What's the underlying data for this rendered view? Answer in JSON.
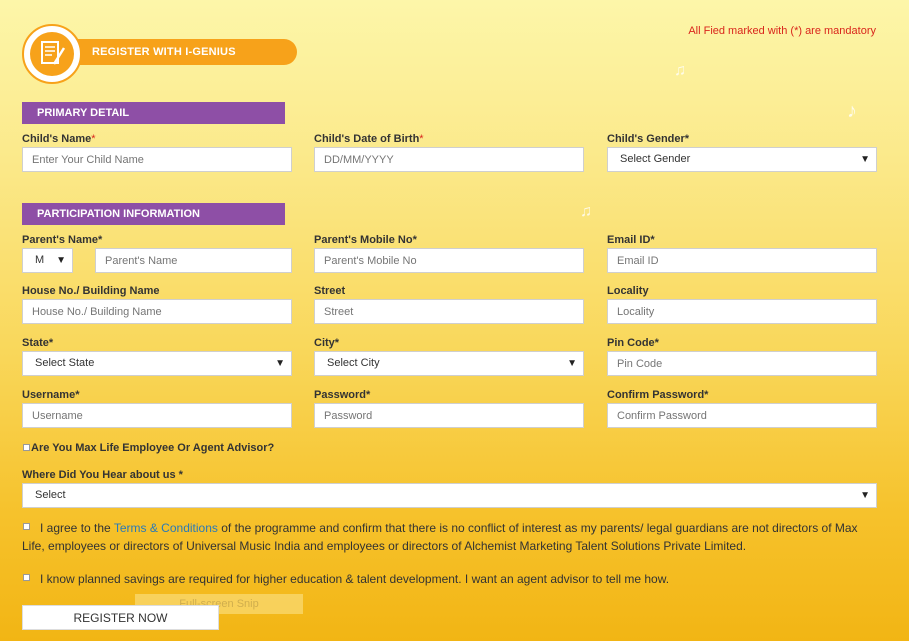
{
  "header": {
    "badge_label": "REGISTER WITH I-GENIUS",
    "mandatory_note": "All Fied marked with (*) are mandatory"
  },
  "primary": {
    "title": "PRIMARY DETAIL",
    "child_name": {
      "label": "Child's Name",
      "placeholder": "Enter Your Child Name"
    },
    "child_dob": {
      "label": "Child's Date of Birth",
      "placeholder": "DD/MM/YYYY"
    },
    "child_gender": {
      "label": "Child's Gender*",
      "selected": "Select Gender"
    }
  },
  "participation": {
    "title": "PARTICIPATION INFORMATION",
    "parent_name": {
      "label": "Parent's Name*",
      "salutation": "M",
      "placeholder": "Parent's Name"
    },
    "parent_mobile": {
      "label": "Parent's Mobile No*",
      "placeholder": "Parent's Mobile No"
    },
    "email": {
      "label": "Email ID*",
      "placeholder": "Email ID"
    },
    "house": {
      "label": "House No./ Building Name",
      "placeholder": "House No./ Building Name"
    },
    "street": {
      "label": "Street",
      "placeholder": "Street"
    },
    "locality": {
      "label": "Locality",
      "placeholder": "Locality"
    },
    "state": {
      "label": "State*",
      "selected": "Select State"
    },
    "city": {
      "label": "City*",
      "selected": "Select City"
    },
    "pincode": {
      "label": "Pin Code*",
      "placeholder": "Pin Code"
    },
    "username": {
      "label": "Username*",
      "placeholder": "Username"
    },
    "password": {
      "label": "Password*",
      "placeholder": "Password"
    },
    "confirm_password": {
      "label": "Confirm Password*",
      "placeholder": "Confirm Password"
    }
  },
  "employee_check": "Are You Max Life Employee Or Agent Advisor?",
  "hear_about": {
    "label": "Where Did You Hear about us *",
    "selected": "Select"
  },
  "terms": {
    "prefix": "I agree to the ",
    "link": "Terms & Conditions",
    "line1_suffix": " of the programme and confirm that there is no conflict of interest as my parents/ legal guardians are not directors of Max",
    "line2": "Life, employees or directors of Universal Music India and employees or directors of Alchemist Marketing Talent Solutions Private Limited."
  },
  "savings_check": "I know planned savings are required for higher education & talent development. I want an agent advisor to tell me how.",
  "register_button": "REGISTER NOW",
  "snip_overlay": "Full-screen Snip",
  "colors": {
    "accent_orange": "#f7a21a",
    "section_purple": "#8e4fa6",
    "required_red": "#d9261c",
    "link_blue": "#2a7ab8"
  }
}
